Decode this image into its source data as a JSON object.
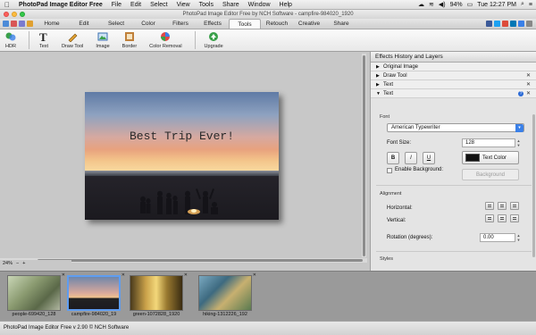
{
  "menubar": {
    "app_name": "PhotoPad Image Editor Free",
    "items": [
      "File",
      "Edit",
      "Select",
      "View",
      "Tools",
      "Share",
      "Window",
      "Help"
    ],
    "battery": "94%",
    "clock": "Tue 12:27 PM"
  },
  "window": {
    "title": "PhotoPad Image Editor Free by NCH Software - campfire-984020_1920"
  },
  "tabs": {
    "items": [
      "Home",
      "Edit",
      "Select",
      "Color",
      "Filters",
      "Effects",
      "Tools",
      "Retouch",
      "Creative",
      "Share"
    ],
    "active": "Tools"
  },
  "toolbar": {
    "buttons": [
      {
        "label": "HDR",
        "icon": "hdr-icon"
      },
      {
        "label": "Text",
        "icon": "text-icon"
      },
      {
        "label": "Draw Tool",
        "icon": "pencil-icon"
      },
      {
        "label": "Image",
        "icon": "image-icon"
      },
      {
        "label": "Border",
        "icon": "border-icon"
      },
      {
        "label": "Color Removal",
        "icon": "color-removal-icon"
      },
      {
        "label": "Upgrade",
        "icon": "upgrade-icon"
      }
    ]
  },
  "canvas": {
    "overlay_text": "Best Trip Ever!",
    "zoom": "24%",
    "zoom_minus": "−",
    "zoom_plus": "+"
  },
  "panel": {
    "header": "Effects History and Layers",
    "history": [
      {
        "label": "Original Image",
        "expanded": false,
        "closable": false
      },
      {
        "label": "Draw Tool",
        "expanded": false,
        "closable": true
      },
      {
        "label": "Text",
        "expanded": false,
        "closable": true
      },
      {
        "label": "Text",
        "expanded": true,
        "closable": true
      }
    ],
    "font_section": "Font",
    "font_value": "American Typewriter",
    "font_size_label": "Font Size:",
    "font_size_value": "128",
    "bold": "B",
    "italic": "I",
    "underline": "U",
    "text_color_label": "Text Color",
    "text_color": "#111111",
    "enable_background_label": "Enable Background:",
    "background_label": "Background",
    "alignment_section": "Alignment",
    "horizontal_label": "Horizontal:",
    "vertical_label": "Vertical:",
    "rotation_label": "Rotation (degrees):",
    "rotation_value": "0.00",
    "styles_section": "Styles"
  },
  "thumbnails": [
    {
      "name": "people-699420_128",
      "selected": false
    },
    {
      "name": "campfire-984020_19",
      "selected": true
    },
    {
      "name": "green-1072828_1920",
      "selected": false
    },
    {
      "name": "hiking-1312226_192",
      "selected": false
    }
  ],
  "status": {
    "text": "PhotoPad Image Editor Free v 2.90 © NCH Software"
  },
  "colors": {
    "accent": "#3a80e8",
    "selection": "#5f9df0"
  }
}
